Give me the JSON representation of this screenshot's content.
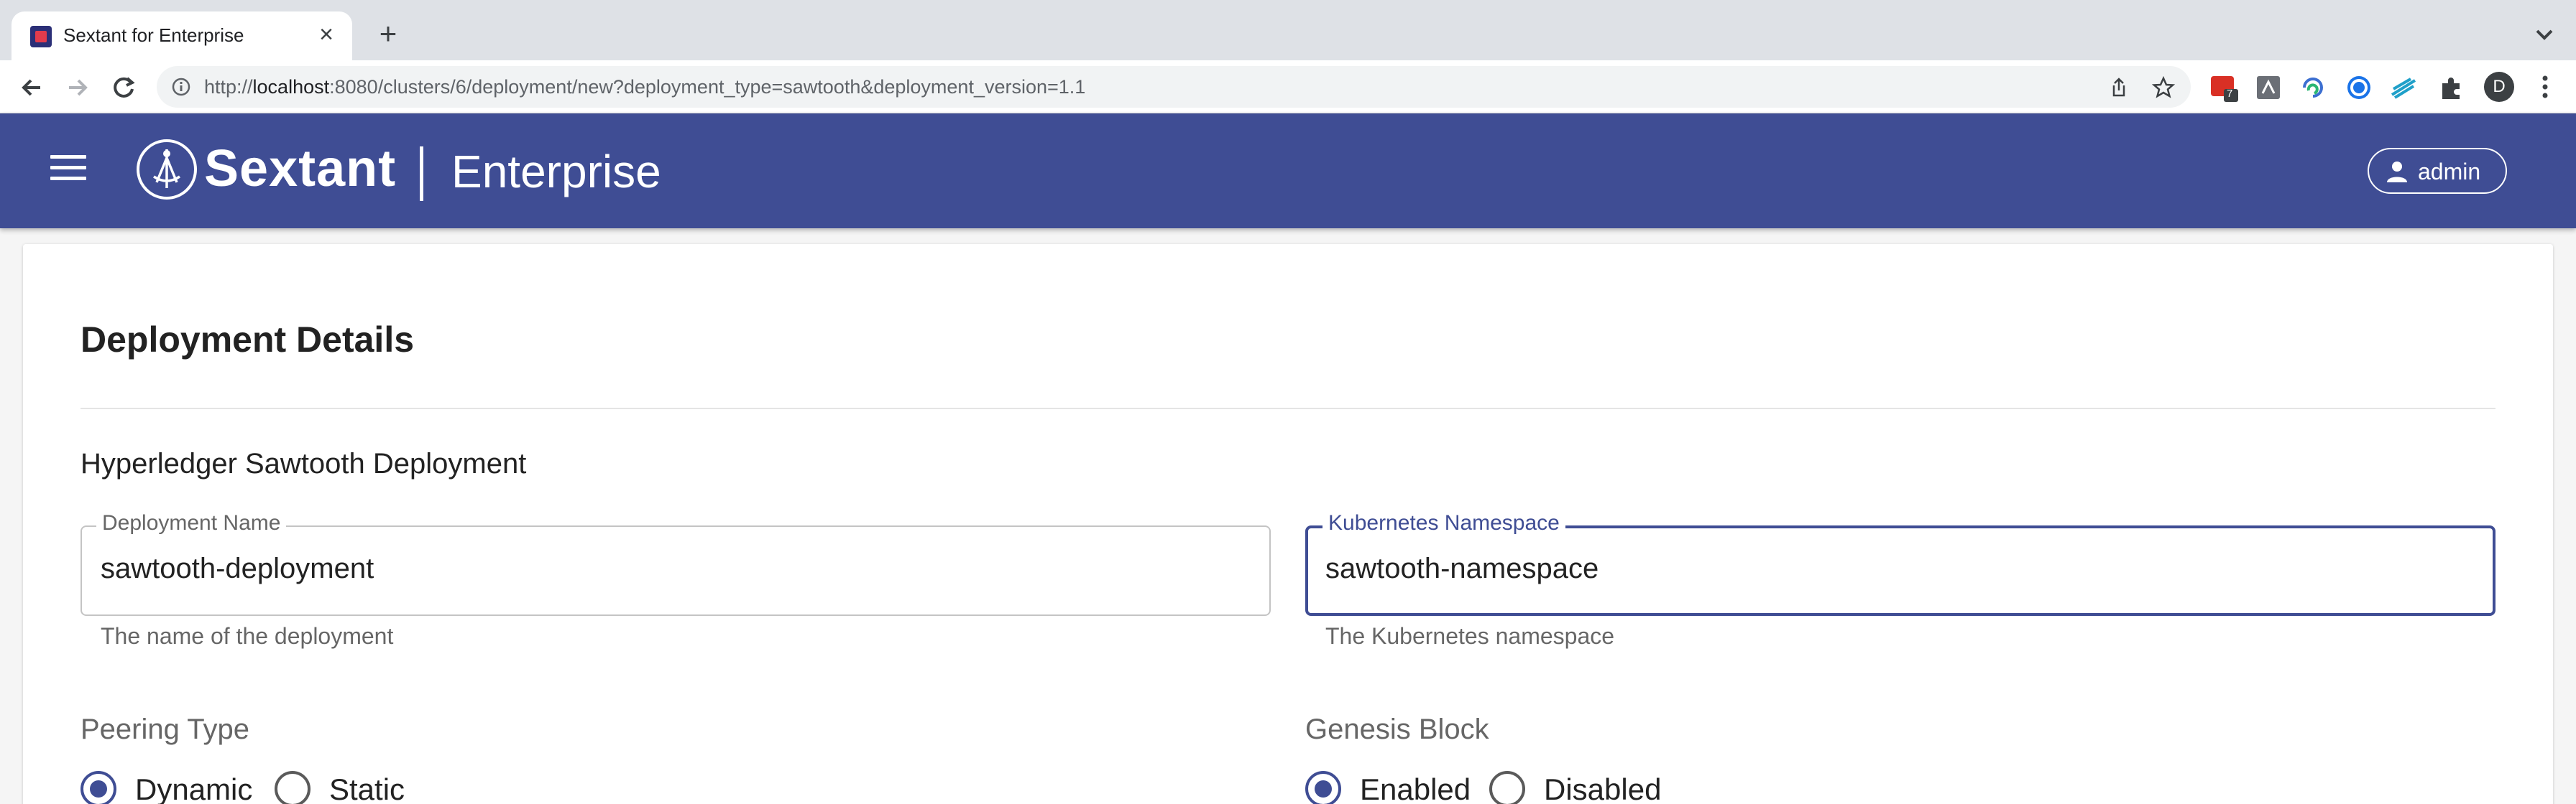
{
  "browser": {
    "tab_title": "Sextant for Enterprise",
    "tab_close": "×",
    "new_tab": "+",
    "url_prefix": "http://",
    "url_host": "localhost",
    "url_rest": ":8080/clusters/6/deployment/new?deployment_type=sawtooth&deployment_version=1.1",
    "extension_badge": "7",
    "profile_initial": "D"
  },
  "app": {
    "brand": "Sextant",
    "brand_sub": "Enterprise",
    "user_label": "admin",
    "accent_color": "#3f4d94"
  },
  "form": {
    "title": "Deployment Details",
    "section": "Hyperledger Sawtooth Deployment",
    "deployment_name": {
      "label": "Deployment Name",
      "value": "sawtooth-deployment",
      "helper": "The name of the deployment"
    },
    "namespace": {
      "label": "Kubernetes Namespace",
      "value": "sawtooth-namespace",
      "helper": "The Kubernetes namespace"
    },
    "peering": {
      "label": "Peering Type",
      "options": [
        "Dynamic",
        "Static"
      ],
      "selected": "Dynamic"
    },
    "genesis": {
      "label": "Genesis Block",
      "options": [
        "Enabled",
        "Disabled"
      ],
      "selected": "Enabled"
    }
  }
}
